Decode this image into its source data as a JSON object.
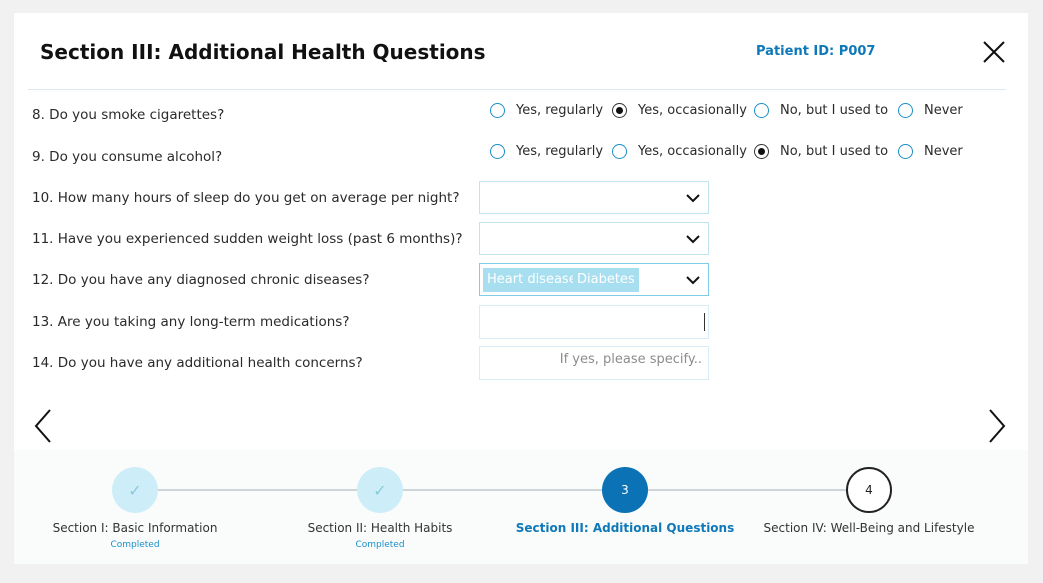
{
  "header": {
    "title": "Section III: Additional Health Questions",
    "patient_id": "Patient ID: P007"
  },
  "questions": [
    {
      "label": "8. Do you smoke cigarettes?",
      "type": "radio",
      "options": [
        "Yes, regularly",
        "Yes, occasionally",
        "No, but I used to",
        "Never"
      ],
      "selected": "Yes, occasionally"
    },
    {
      "label": "9. Do you consume alcohol?",
      "type": "radio",
      "options": [
        "Yes, regularly",
        "Yes, occasionally",
        "No, but I used to",
        "Never"
      ],
      "selected": "No, but I used to"
    },
    {
      "label": "10. How many hours of sleep do you get on average per night?",
      "type": "select",
      "value": ""
    },
    {
      "label": "11. Have you experienced sudden weight loss (past 6 months)?",
      "type": "select",
      "value": ""
    },
    {
      "label": "12. Do you have any diagnosed chronic diseases?",
      "type": "multiselect",
      "tags": [
        "Heart disease",
        "Diabetes"
      ]
    },
    {
      "label": "13. Are you taking any long-term medications?",
      "type": "text",
      "value": ""
    },
    {
      "label": "14. Do you have any additional health concerns?",
      "type": "text",
      "value": "",
      "placeholder": "If yes, please specify.."
    }
  ],
  "stepper": {
    "steps": [
      {
        "label": "Section I: Basic Information",
        "status": "Completed",
        "state": "done",
        "marker": "✓"
      },
      {
        "label": "Section II: Health Habits",
        "status": "Completed",
        "state": "done",
        "marker": "✓"
      },
      {
        "label": "Section III: Additional Questions",
        "status": "",
        "state": "current",
        "marker": "3"
      },
      {
        "label": "Section IV: Well-Being and Lifestyle",
        "status": "",
        "state": "todo",
        "marker": "4"
      }
    ]
  },
  "colors": {
    "accent": "#0a72b5",
    "radio_border": "#1a8fc9",
    "tag_bg": "#a8dff0",
    "completed_circle": "#cdeef8"
  },
  "icons": {
    "close": "close-icon",
    "prev": "chevron-left-icon",
    "next": "chevron-right-icon",
    "dropdown": "chevron-down-icon",
    "done": "check-icon"
  }
}
